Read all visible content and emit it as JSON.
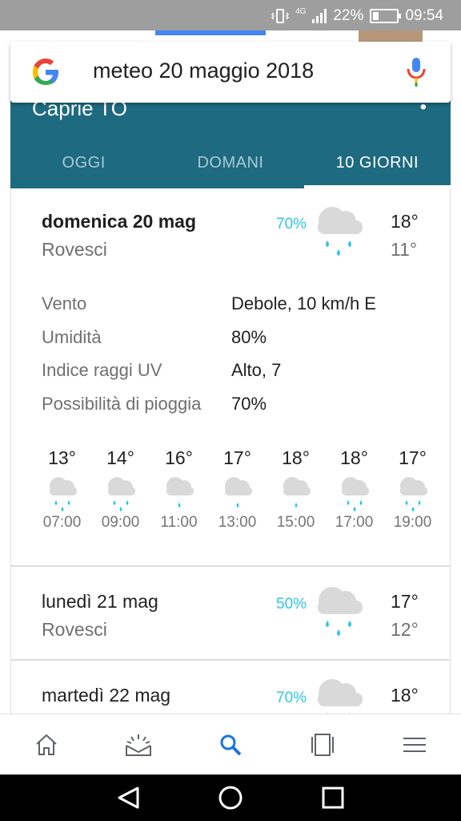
{
  "status_bar": {
    "network": "4G",
    "battery": "22%",
    "battery_level": 0.22,
    "time": "09:54"
  },
  "search": {
    "query": "meteo 20 maggio 2018"
  },
  "weather": {
    "location": "Caprie TO",
    "tabs": [
      {
        "label": "OGGI",
        "active": false
      },
      {
        "label": "DOMANI",
        "active": false
      },
      {
        "label": "10 GIORNI",
        "active": true
      }
    ],
    "days": [
      {
        "name": "domenica 20 mag",
        "condition": "Rovesci",
        "precip": "70%",
        "high": "18°",
        "low": "11°",
        "icon": "cloud-rain-icon",
        "details": [
          {
            "label": "Vento",
            "value": "Debole, 10 km/h E"
          },
          {
            "label": "Umidità",
            "value": "80%"
          },
          {
            "label": "Indice raggi UV",
            "value": "Alto, 7"
          },
          {
            "label": "Possibilità di pioggia",
            "value": "70%"
          }
        ],
        "hourly": [
          {
            "temp": "13°",
            "time": "07:00",
            "drops": 3
          },
          {
            "temp": "14°",
            "time": "09:00",
            "drops": 3
          },
          {
            "temp": "16°",
            "time": "11:00",
            "drops": 1
          },
          {
            "temp": "17°",
            "time": "13:00",
            "drops": 1
          },
          {
            "temp": "18°",
            "time": "15:00",
            "drops": 1
          },
          {
            "temp": "18°",
            "time": "17:00",
            "drops": 3
          },
          {
            "temp": "17°",
            "time": "19:00",
            "drops": 3
          }
        ]
      },
      {
        "name": "lunedì 21 mag",
        "condition": "Rovesci",
        "precip": "50%",
        "high": "17°",
        "low": "12°",
        "icon": "cloud-rain-icon"
      },
      {
        "name": "martedì 22 mag",
        "precip": "70%",
        "high": "18°",
        "icon": "cloud-rain-icon"
      }
    ]
  },
  "bottom_nav": [
    {
      "icon": "home-icon"
    },
    {
      "icon": "updates-icon"
    },
    {
      "icon": "search-icon",
      "active": true
    },
    {
      "icon": "tabs-icon"
    },
    {
      "icon": "menu-icon"
    }
  ],
  "colors": {
    "header": "#1e6a80",
    "accent_blue": "#4285f4",
    "precip": "#2ec7e6"
  }
}
